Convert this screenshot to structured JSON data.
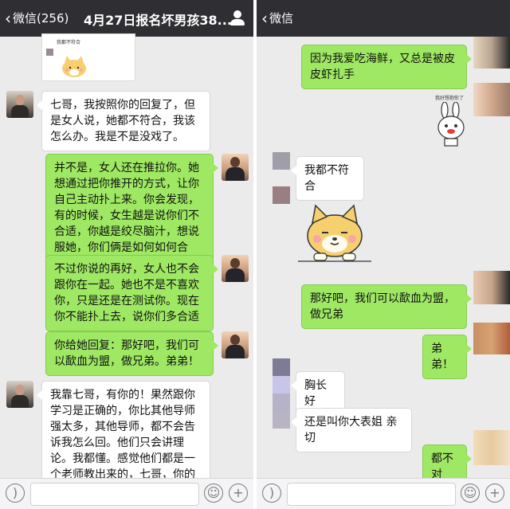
{
  "left": {
    "nav": {
      "back_label": "微信(256)",
      "title": "4月27日报名坏男孩38..."
    },
    "sticker_caption": "我都不符合",
    "messages": [
      {
        "text": "七哥，我按照你的回复了，但是女人说，她都不符合，我该怎么办。我是不是没戏了。"
      },
      {
        "text": "并不是，女人还在推拉你。她想通过把你推开的方式，让你自己主动扑上来。你会发现，有的时候，女生越是说你们不合适，你越是绞尽脑汁，想说服她，你们俩是如何如何合适。"
      },
      {
        "text": "不过你说的再好，女人也不会跟你在一起。她也不是不喜欢你，只是还是在测试你。现在你不能扑上去，说你们多合适"
      },
      {
        "text": "你给她回复：那好吧，我们可以歃血为盟，做兄弟。弟弟！"
      },
      {
        "text": "我靠七哥，有你的！果然跟你学习是正确的，你比其他导师强太多，其他导师，都不会告诉我怎么回。他们只会讲理论。我都懂。感觉他们都是一个老师教出来的，七哥，你的确不一样！"
      }
    ]
  },
  "right": {
    "nav": {
      "back_label": "微信"
    },
    "sticker_caption": "我好想抱你了",
    "messages": [
      {
        "text": "因为我爱吃海鲜，又总是被皮皮虾扎手"
      },
      {
        "text": "我都不符合"
      },
      {
        "text": "那好吧，我们可以歃血为盟，做兄弟"
      },
      {
        "text": "弟弟！"
      },
      {
        "text": "胸长 好"
      },
      {
        "text": "还是叫你大表姐 亲切"
      },
      {
        "text": "都不对"
      }
    ]
  },
  "colors": {
    "navbar": "#2e2e33",
    "chat_bg": "#ebebeb",
    "sent_bubble": "#9ee863",
    "received_bubble": "#ffffff"
  },
  "icons": [
    "back-chevron-icon",
    "person-icon",
    "voice-icon",
    "emoji-icon",
    "plus-icon"
  ]
}
